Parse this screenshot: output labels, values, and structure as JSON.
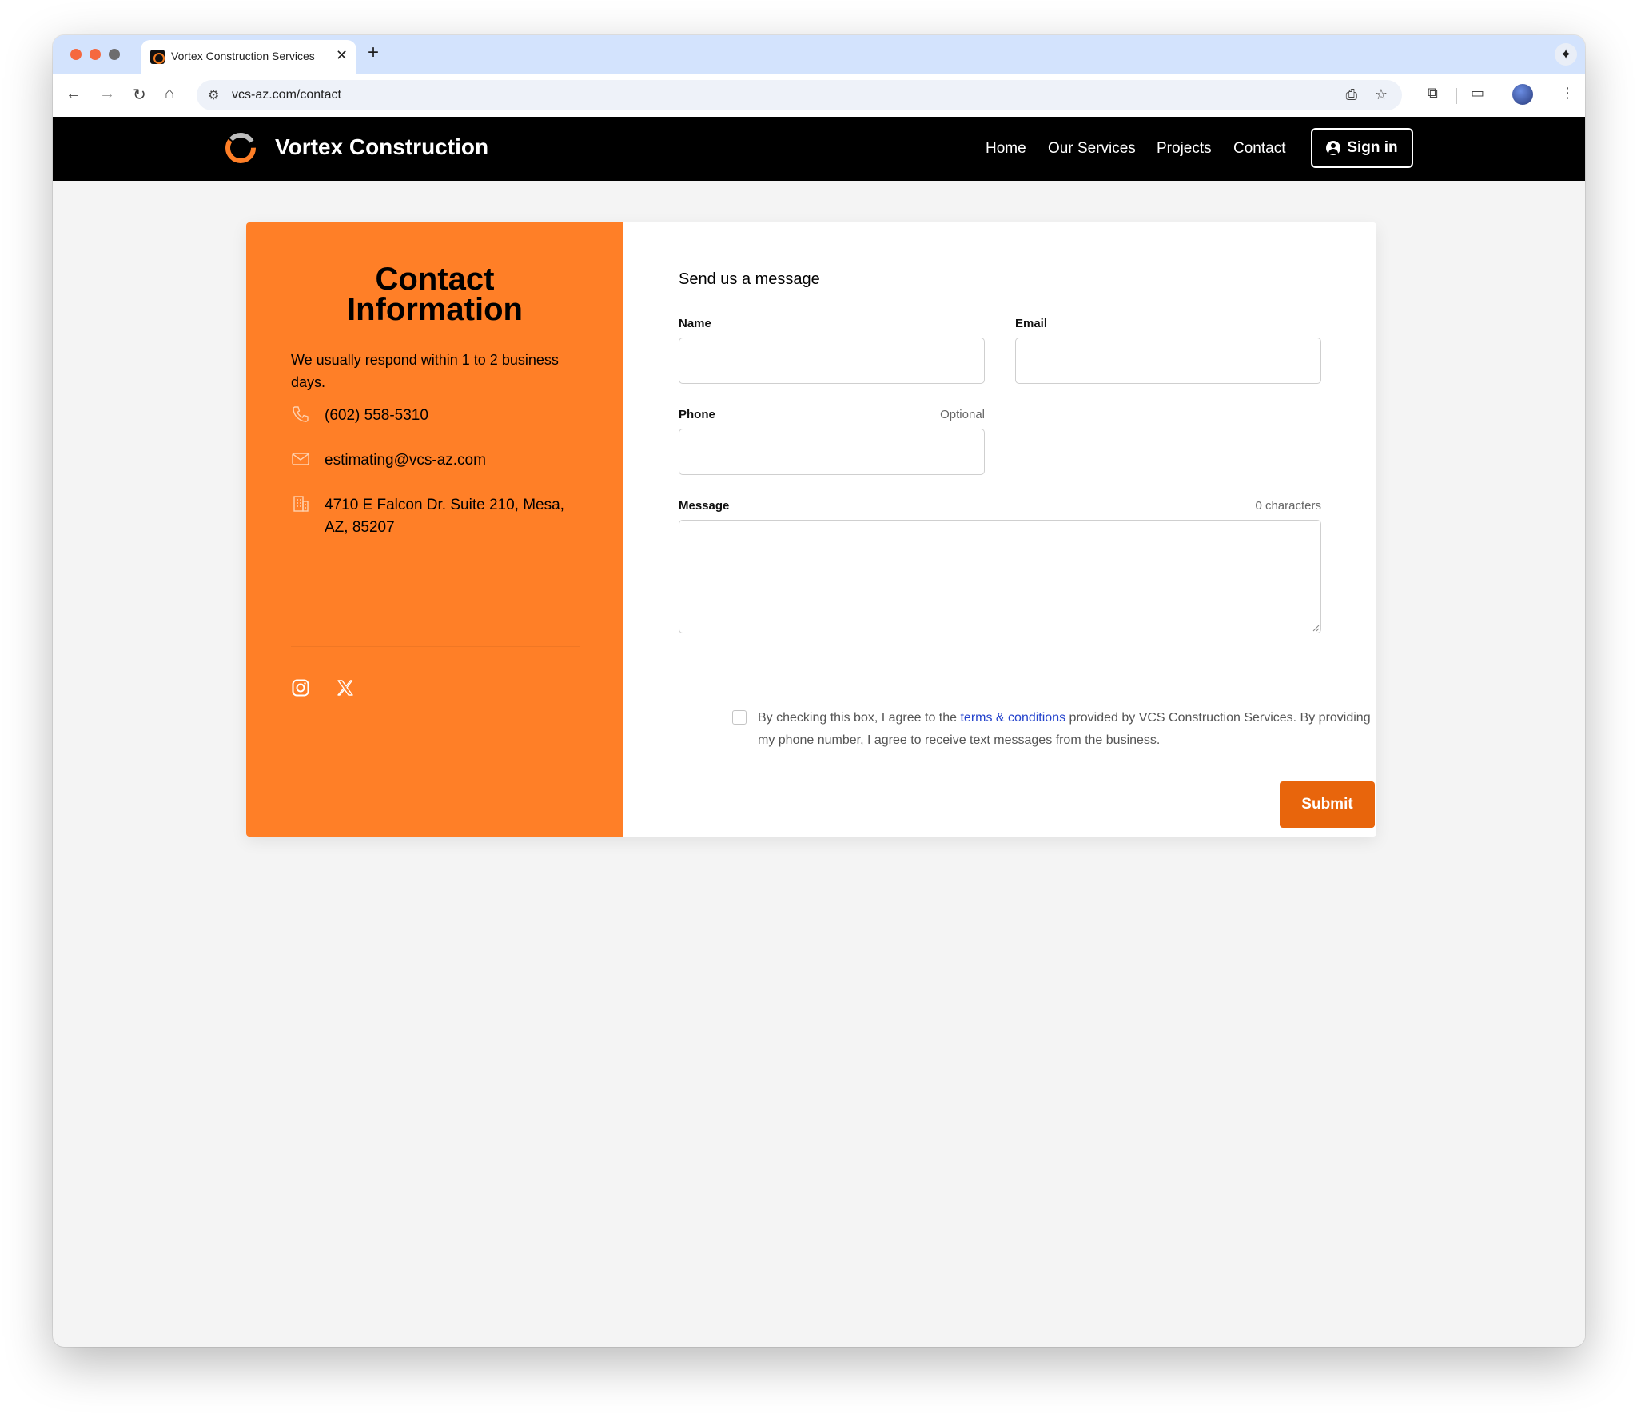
{
  "browser": {
    "tab_title": "Vortex Construction Services",
    "url": "vcs-az.com/contact"
  },
  "site": {
    "brand": "Vortex Construction",
    "nav": [
      "Home",
      "Our Services",
      "Projects",
      "Contact"
    ],
    "signin_label": "Sign in"
  },
  "info": {
    "title": "Contact Information",
    "subtitle": "We usually respond within 1 to 2 business days.",
    "phone": "(602) 558-5310",
    "email": "estimating@vcs-az.com",
    "address": "4710 E Falcon Dr. Suite 210, Mesa, AZ, 85207"
  },
  "form": {
    "title": "Send us a message",
    "name_label": "Name",
    "email_label": "Email",
    "phone_label": "Phone",
    "phone_hint": "Optional",
    "message_label": "Message",
    "message_counter": "0 characters",
    "name_value": "",
    "email_value": "",
    "phone_value": "",
    "message_value": "",
    "consent_pre": "By checking this box, I agree to the ",
    "consent_link": "terms & conditions",
    "consent_post": " provided by VCS Construction Services. By providing my phone number, I agree to receive text messages from the business.",
    "submit_label": "Submit"
  },
  "colors": {
    "accent": "#ff7f27",
    "submit": "#e8650c",
    "header": "#000000",
    "link": "#2443cc"
  },
  "icons": {
    "phone": "phone-icon",
    "email": "envelope-icon",
    "address": "building-icon",
    "social": [
      "instagram-icon",
      "x-icon"
    ]
  }
}
